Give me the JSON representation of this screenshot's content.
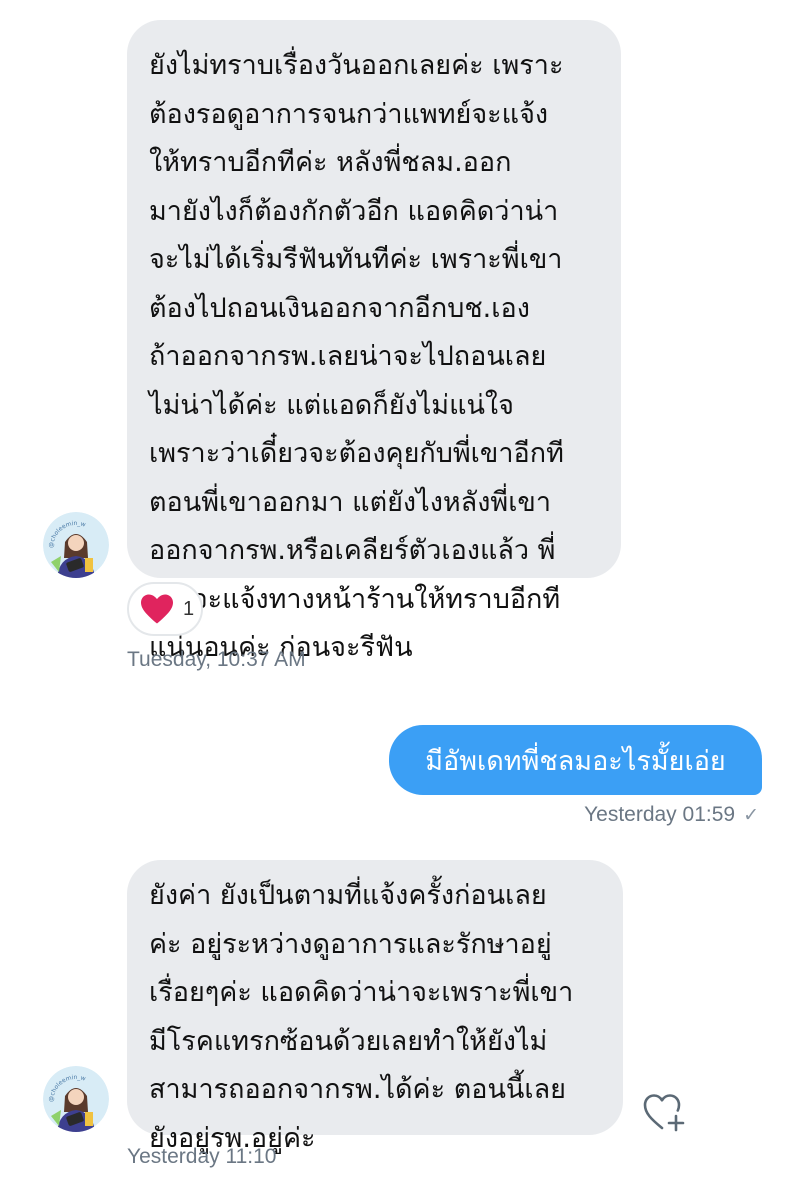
{
  "messages": [
    {
      "lines": [
        "ยังไม่ทราบเรื่องวันออกเลยค่ะ เพราะ",
        "ต้องรอดูอาการจนกว่าแพทย์จะแจ้ง",
        "ให้ทราบอีกทีค่ะ หลังพี่ชลม.ออก",
        "มายังไงก็ต้องกักตัวอีก แอดคิดว่าน่า",
        "จะไม่ได้เริ่มรีฟันทันทีค่ะ เพราะพี่เขา",
        "ต้องไปถอนเงินออกจากอีกบช.เอง",
        "ถ้าออกจากรพ.เลยน่าจะไปถอนเลย",
        "ไม่น่าได้ค่ะ แต่แอดก็ยังไม่แน่ใจ",
        "เพราะว่าเดี๋ยวจะต้องคุยกับพี่เขาอีกที",
        "ตอนพี่เขาออกมา แต่ยังไงหลังพี่เขา",
        "ออกจากรพ.หรือเคลียร์ตัวเองแล้ว พี่",
        "เขาจะแจ้งทางหน้าร้านให้ทราบอีกที",
        "แน่นอนค่ะ ก่อนจะรีฟัน"
      ],
      "reaction_count": "1",
      "timestamp": "Tuesday, 10:37 AM"
    },
    {
      "text": "มีอัพเดทพี่ชลมอะไรมั้ยเอ่ย",
      "timestamp": "Yesterday 01:59",
      "status": "✓"
    },
    {
      "lines": [
        "ยังค่า ยังเป็นตามที่แจ้งครั้งก่อนเลย",
        "ค่ะ อยู่ระหว่างดูอาการและรักษาอยู่",
        "เรื่อยๆค่ะ แอดคิดว่าน่าจะเพราะพี่เขา",
        "มีโรคแทรกซ้อนด้วยเลยทำให้ยังไม่",
        "สามารถออกจากรพ.ได้ค่ะ ตอนนี้เลย",
        "ยังอยู่รพ.อยู่ค่ะ"
      ],
      "timestamp": "Yesterday 11:10"
    }
  ],
  "avatar_text": "@choleemin_w",
  "colors": {
    "incoming_bg": "#e9ebee",
    "outgoing_bg": "#3b9ff5",
    "heart": "#e0245e"
  }
}
